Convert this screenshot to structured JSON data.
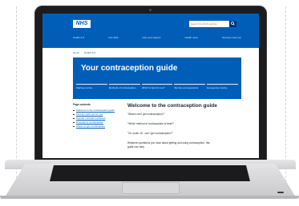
{
  "header": {
    "logo": "NHS",
    "search_placeholder": "Search the NHS website",
    "nav": [
      "Health A-Z",
      "Live Well",
      "Care and support",
      "Health news",
      "Services near you"
    ]
  },
  "breadcrumbs": [
    "Home",
    "Health A-Z"
  ],
  "hero": {
    "title": "Your contraception guide",
    "links": [
      "Starting contra...",
      "Methods of contraception",
      "Which is best for me?",
      "Worries and questions",
      "Emergency contra..."
    ]
  },
  "contents": {
    "title": "Page contents",
    "items": [
      "Welcome to the contraception guide",
      "Find the right one for you",
      "Popular methods explained",
      "Emergency contraception",
      "Where to get contraception"
    ]
  },
  "main": {
    "title": "Welcome to the contraception guide",
    "questions": [
      "\"Where can I get contraception?\"",
      "\"Which method of contraception is best?\"",
      "\"I'm under 16 - can I get contraception?\""
    ],
    "intro": "Whatever questions you have about getting and using contraception, this guide can help."
  },
  "colors": {
    "nhs_blue": "#005eb8",
    "nhs_dark_blue": "#003087",
    "text": "#212b32"
  }
}
